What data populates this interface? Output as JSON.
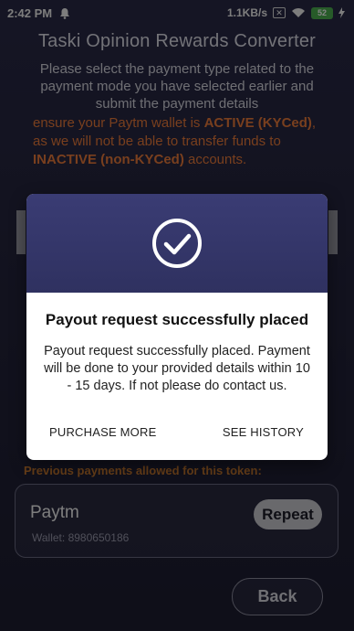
{
  "status_bar": {
    "time": "2:42 PM",
    "speed": "1.1KB/s",
    "battery": "52"
  },
  "background": {
    "title": "Taski Opinion Rewards Converter",
    "instructions": "Please select the payment type related to the payment mode you have selected earlier and submit the payment details",
    "warning": {
      "p1": "ensure your Paytm wallet is ",
      "active": "ACTIVE (KYCed)",
      "p2": ", as we will not be able to transfer funds to ",
      "inactive": "INACTIVE (non-KYCed)",
      "p3": " accounts."
    },
    "previous_label": "Previous payments allowed for this token:",
    "payment": {
      "name": "Paytm",
      "wallet_label": "Wallet:",
      "wallet_number": "8980650186",
      "repeat_label": "Repeat"
    },
    "back_label": "Back"
  },
  "dialog": {
    "title": "Payout request successfully placed",
    "message": "Payout request successfully placed. Payment will be done to your provided details within 10 - 15 days. If not please do contact us.",
    "purchase_more_label": "PURCHASE MORE",
    "see_history_label": "SEE HISTORY"
  },
  "colors": {
    "warning": "#e87a3a",
    "dialog_header": "#34366a",
    "previous_label": "#c6782f"
  }
}
